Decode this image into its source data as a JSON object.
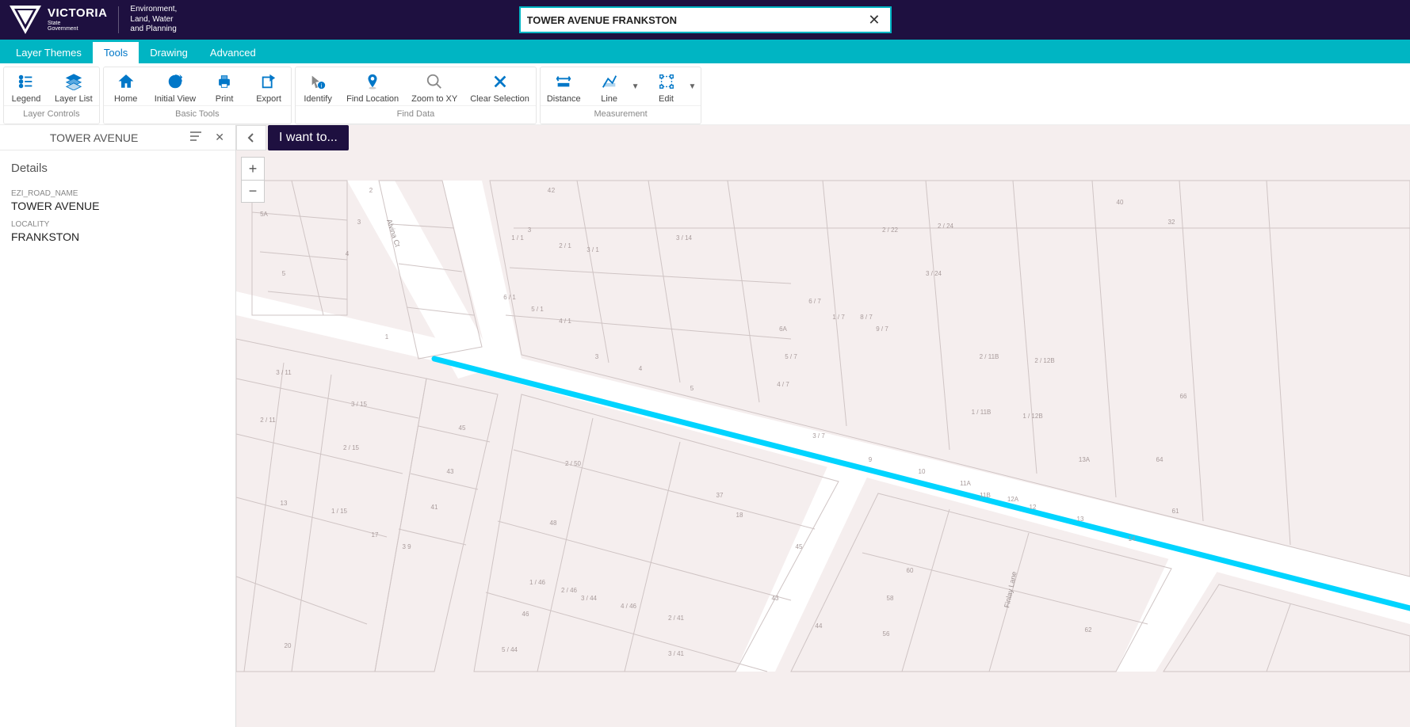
{
  "header": {
    "logo_primary": "VICTORIA",
    "logo_sub1": "State",
    "logo_sub2": "Government",
    "dept_l1": "Environment,",
    "dept_l2": "Land, Water",
    "dept_l3": "and Planning",
    "search_value": "TOWER AVENUE FRANKSTON"
  },
  "tabs": {
    "items": [
      "Layer Themes",
      "Tools",
      "Drawing",
      "Advanced"
    ],
    "active": 1
  },
  "ribbon": {
    "groups": [
      {
        "label": "Layer Controls",
        "items": [
          "Legend",
          "Layer List"
        ]
      },
      {
        "label": "Basic Tools",
        "items": [
          "Home",
          "Initial View",
          "Print",
          "Export"
        ]
      },
      {
        "label": "Find Data",
        "items": [
          "Identify",
          "Find Location",
          "Zoom to XY",
          "Clear Selection"
        ]
      },
      {
        "label": "Measurement",
        "items": [
          "Distance",
          "Line",
          "Edit"
        ]
      }
    ]
  },
  "side": {
    "title": "TOWER AVENUE",
    "section": "Details",
    "fields": [
      {
        "label": "EZI_ROAD_NAME",
        "value": "TOWER AVENUE"
      },
      {
        "label": "LOCALITY",
        "value": "FRANKSTON"
      }
    ]
  },
  "map": {
    "iwant": "I want to...",
    "streets": {
      "alvina": "Alvina Ct",
      "finlay": "Finlay Lane"
    },
    "parcel_labels": [
      "5A",
      "5",
      "4",
      "3",
      "2",
      "1",
      "3 / 11",
      "2 / 11",
      "3 / 15",
      "2 / 15",
      "1 / 15",
      "13",
      "20",
      "45",
      "43",
      "41",
      "3 9",
      "17",
      "4",
      "3",
      "2",
      "1",
      "1 / 1",
      "2 / 1",
      "3 / 1",
      "6 / 1",
      "5 / 1",
      "4 / 1",
      "3 / 14",
      "2",
      "3",
      "4",
      "5",
      "2 / 50",
      "48",
      "1 / 46",
      "46",
      "2 / 46",
      "5 / 44",
      "3 / 44",
      "4 / 46",
      "2 / 41",
      "3 / 41",
      "37",
      "18",
      "45",
      "43",
      "2 / 24",
      "2 / 22",
      "3 / 24",
      "6 / 7",
      "1 / 7",
      "8 / 7",
      "9 / 7",
      "5 / 7",
      "4 / 7",
      "3 / 7",
      "6A",
      "9",
      "10",
      "11A",
      "11B",
      "12A",
      "1 / 11B",
      "1 / 12B",
      "2 / 11B",
      "2 / 12B",
      "40",
      "32",
      "66",
      "64",
      "61",
      "13A",
      "13",
      "14",
      "12",
      "62",
      "56",
      "58",
      "60",
      "44"
    ]
  }
}
